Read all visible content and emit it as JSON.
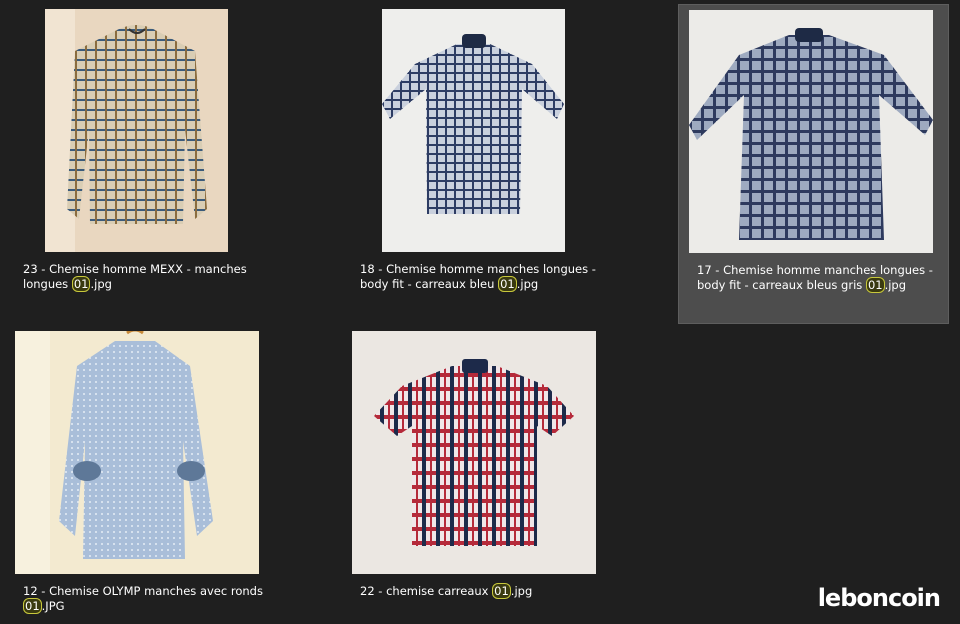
{
  "files": [
    {
      "line1": "23 - Chemise homme MEXX - manches",
      "line2_pre": "longues ",
      "match": "01",
      "line2_post": ".jpg",
      "selected": false
    },
    {
      "line1": "18 - Chemise homme manches longues -",
      "line2_pre": "body fit - carreaux bleu ",
      "match": "01",
      "line2_post": ".jpg",
      "selected": false
    },
    {
      "line1": "17 - Chemise homme manches longues -",
      "line2_pre": "body fit - carreaux bleus  gris ",
      "match": "01",
      "line2_post": ".jpg",
      "selected": true
    },
    {
      "line1": "12 - Chemise OLYMP manches avec ronds",
      "line2_pre": "",
      "match": "01",
      "line2_post": ".JPG",
      "selected": false
    },
    {
      "line1": "22 - chemise carreaux ",
      "line2_pre": "",
      "match": "01",
      "line2_post": ".jpg",
      "selected": false,
      "single_line": true
    }
  ],
  "watermark": "leboncoin",
  "colors": {
    "background": "#1f1f1f",
    "selected_tile": "#4d4d4d",
    "highlight_border": "#c8c83c"
  }
}
